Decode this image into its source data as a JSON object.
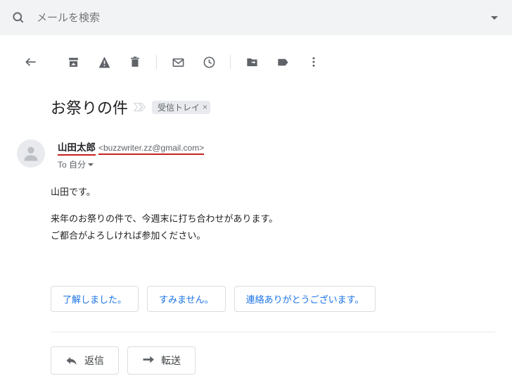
{
  "search": {
    "placeholder": "メールを検索"
  },
  "subject": "お祭りの件",
  "inbox_label": "受信トレイ",
  "sender": {
    "name": "山田太郎",
    "email": "<buzzwriter.zz@gmail.com>"
  },
  "recipient_line": "To 自分",
  "body": {
    "line1": "山田です。",
    "line2": "来年のお祭りの件で、今週末に打ち合わせがあります。",
    "line3": "ご都合がよろしければ参加ください。"
  },
  "smart_replies": {
    "r1": "了解しました。",
    "r2": "すみません。",
    "r3": "連絡ありがとうございます。"
  },
  "actions": {
    "reply": "返信",
    "forward": "転送"
  }
}
